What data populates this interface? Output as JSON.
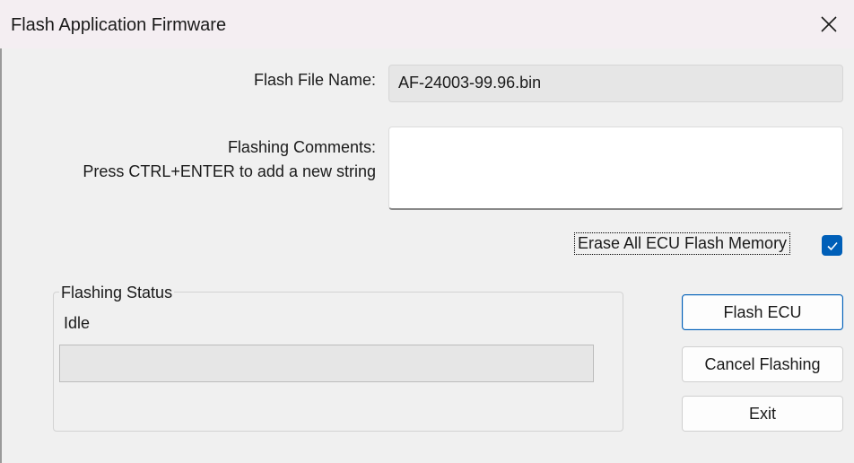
{
  "window": {
    "title": "Flash Application Firmware"
  },
  "form": {
    "file_name_label": "Flash File Name:",
    "file_name_value": "AF-24003-99.96.bin",
    "comments_label_line1": "Flashing Comments:",
    "comments_label_line2": "Press CTRL+ENTER to add a new string",
    "comments_value": "",
    "erase_label": "Erase All ECU Flash Memory",
    "erase_checked": true
  },
  "status": {
    "group_title": "Flashing Status",
    "text": "Idle",
    "progress": 0
  },
  "buttons": {
    "flash": "Flash ECU",
    "cancel": "Cancel Flashing",
    "exit": "Exit"
  },
  "icons": {
    "close": "close-icon",
    "check": "checkmark-icon"
  },
  "colors": {
    "accent": "#005fb8",
    "titlebar": "#f4eef2",
    "window_bg": "#f0f0f0"
  }
}
